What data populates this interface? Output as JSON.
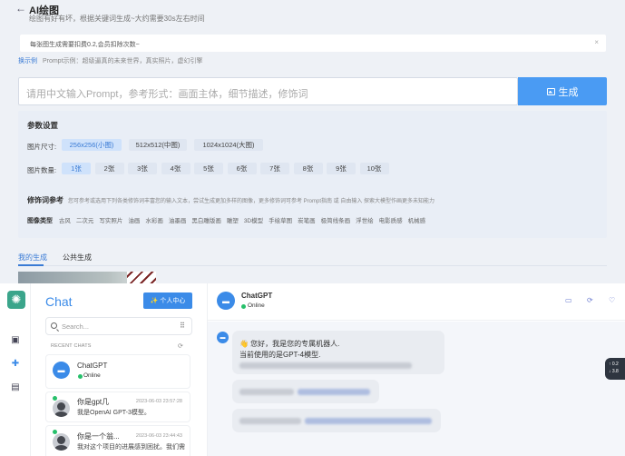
{
  "header": {
    "back_icon": "←",
    "title": "AI绘图",
    "subtitle": "绘图有好有坏，根据关键词生成~大约需要30s左右时间"
  },
  "notice": {
    "text": "每张图生成需要扣费0.2,会员扣除次数~",
    "close": "×"
  },
  "example": {
    "link": "换示例",
    "text": "Prompt示例：超级逼真的未来世界，真实照片，虚幻引擎"
  },
  "prompt": {
    "placeholder": "请用中文输入Prompt，参考形式：画面主体，细节描述，修饰词",
    "generate_label": "生成"
  },
  "params": {
    "title": "参数设置",
    "size_label": "图片尺寸:",
    "sizes": [
      "256x256(小图)",
      "512x512(中图)",
      "1024x1024(大图)"
    ],
    "selected_size": 0,
    "count_label": "图片数量:",
    "counts": [
      "1张",
      "2张",
      "3张",
      "4张",
      "5张",
      "6张",
      "7张",
      "8张",
      "9张",
      "10张"
    ],
    "selected_count": 0,
    "modifier_title": "修饰词参考",
    "modifier_desc": "您可参考或选用下列各类修饰词丰富您的输入文本，尝试生成更加多样的图像，更多修饰词可参考 Prompt指南 或 自由输入 探索大模型作画更多未知能力",
    "image_type_label": "图像类型",
    "image_types": [
      "古风",
      "二次元",
      "写实照片",
      "油画",
      "水彩画",
      "油墨画",
      "黑白雕版画",
      "雕塑",
      "3D模型",
      "手绘草图",
      "炭笔画",
      "极简线条画",
      "浮世绘",
      "电影质感",
      "机械感"
    ]
  },
  "tabs": [
    "我的生成",
    "公共生成"
  ],
  "chat": {
    "logo_icon": "openai-logo",
    "rail_icons": [
      "robot-icon",
      "plus-icon",
      "gallery-icon"
    ],
    "title": "Chat",
    "center_button": "个人中心",
    "search_placeholder": "Search...",
    "recent_label": "RECENT CHATS",
    "conversations": [
      {
        "name": "ChatGPT",
        "status": "Online"
      },
      {
        "name": "你是gpt几",
        "time": "2023-06-03 23:57:28",
        "message": "我是OpenAI GPT-3模型。"
      },
      {
        "name": "你是一个翁...",
        "time": "2023-06-03 23:44:43",
        "message": "我对这个项目的进展感到困扰。我们需"
      }
    ],
    "active": {
      "name": "ChatGPT",
      "status": "Online"
    },
    "messages": [
      {
        "line1": "👋 您好，我是您的专属机器人.",
        "line2": "当前使用的是GPT-4模型."
      }
    ],
    "float_badge": [
      "0.2",
      "3.8"
    ]
  }
}
